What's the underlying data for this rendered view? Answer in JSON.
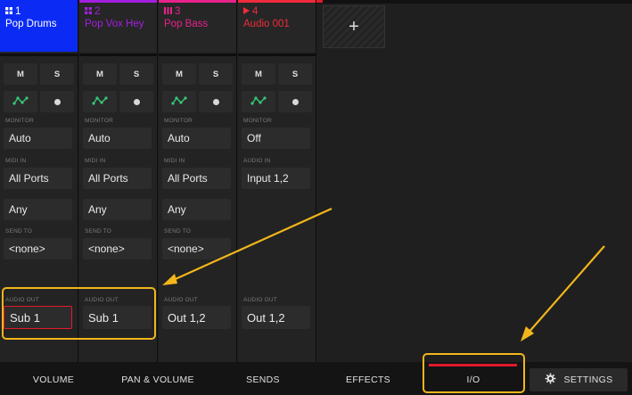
{
  "colors": {
    "accent_red": "#e21b2b",
    "selected_track": "#0b2bf5",
    "highlight": "#f2b61c",
    "track2": "#a21fe0",
    "track3": "#e8228a",
    "track4": "#ef2b3c",
    "routing_icon": "#35c97a"
  },
  "tracks": [
    {
      "number": "1",
      "name": "Pop Drums",
      "icon": "pads-icon",
      "mute": "M",
      "solo": "S",
      "monitor_label": "MONITOR",
      "monitor": "Auto",
      "midi_in_label": "MIDI IN",
      "midi_in": "All Ports",
      "midi_channel": "Any",
      "send_to_label": "SEND TO",
      "send_to": "<none>",
      "audio_out_label": "AUDIO OUT",
      "audio_out": "Sub 1"
    },
    {
      "number": "2",
      "name": "Pop Vox Hey",
      "icon": "pads-icon",
      "mute": "M",
      "solo": "S",
      "monitor_label": "MONITOR",
      "monitor": "Auto",
      "midi_in_label": "MIDI IN",
      "midi_in": "All Ports",
      "midi_channel": "Any",
      "send_to_label": "SEND TO",
      "send_to": "<none>",
      "audio_out_label": "AUDIO OUT",
      "audio_out": "Sub 1"
    },
    {
      "number": "3",
      "name": "Pop Bass",
      "icon": "keys-icon",
      "mute": "M",
      "solo": "S",
      "monitor_label": "MONITOR",
      "monitor": "Auto",
      "midi_in_label": "MIDI IN",
      "midi_in": "All Ports",
      "midi_channel": "Any",
      "send_to_label": "SEND TO",
      "send_to": "<none>",
      "audio_out_label": "AUDIO OUT",
      "audio_out": "Out 1,2"
    },
    {
      "number": "4",
      "name": "Audio 001",
      "icon": "audio-icon",
      "mute": "M",
      "solo": "S",
      "monitor_label": "MONITOR",
      "monitor": "Off",
      "audio_in_label": "AUDIO IN",
      "audio_in": "Input 1,2",
      "audio_out_label": "AUDIO OUT",
      "audio_out": "Out 1,2"
    }
  ],
  "add_track": "+",
  "tabs": {
    "volume": "VOLUME",
    "pan_volume": "PAN & VOLUME",
    "sends": "SENDS",
    "effects": "EFFECTS",
    "io": "I/O",
    "settings": "SETTINGS"
  }
}
